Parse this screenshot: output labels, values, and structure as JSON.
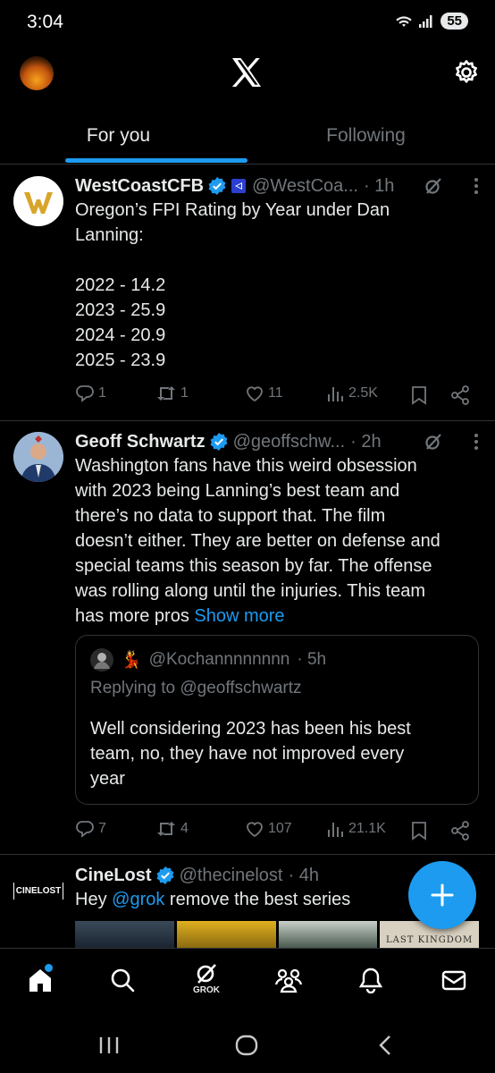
{
  "status_bar": {
    "time": "3:04",
    "battery": "55"
  },
  "tabs": {
    "for_you": "For you",
    "following": "Following"
  },
  "posts": [
    {
      "name": "WestCoastCFB",
      "handle": "@WestCoa...",
      "time": "· 1h",
      "text_lines": [
        "Oregon’s FPI Rating by Year under Dan",
        "Lanning:",
        "",
        "2022 - 14.2",
        "2023 - 25.9",
        "2024 - 20.9",
        "2025 - 23.9"
      ],
      "replies": "1",
      "reposts": "1",
      "likes": "11",
      "views": "2.5K"
    },
    {
      "name": "Geoff Schwartz",
      "handle": "@geoffschw...",
      "time": "· 2h",
      "text_lines": [
        "Washington fans have this weird obsession",
        "with 2023 being Lanning’s best team and",
        "there’s no data to support that. The film",
        "doesn’t either. They are better on defense and",
        "special teams this season by far. The offense",
        "was rolling along until the injuries. This team"
      ],
      "text_last": "has more pros",
      "show_more": "Show more",
      "quote": {
        "emoji": "💃",
        "handle": "@Kochannnnnnnn",
        "time": "· 5h",
        "replying_to": "Replying to @geoffschwartz",
        "text_lines": [
          "Well considering 2023 has been his best",
          "team, no, they have not improved every",
          "year"
        ]
      },
      "replies": "7",
      "reposts": "4",
      "likes": "107",
      "views": "21.1K"
    },
    {
      "name": "CineLost",
      "handle": "@thecinelost",
      "time": "· 4h",
      "text_prefix": "Hey",
      "mention": "@grok",
      "text_suffix": "remove the best series",
      "media_caption": "LAST KINGDOM",
      "avatar_text": "CINELOST"
    }
  ],
  "bottom_nav": {
    "grok_label": "GROK"
  },
  "icons": {
    "settings": "gear-icon",
    "home": "home-icon",
    "search": "search-icon",
    "grok": "grok-icon",
    "communities": "communities-icon",
    "notifications": "bell-icon",
    "messages": "mail-icon",
    "compose": "plus-icon"
  },
  "colors": {
    "accent": "#1d9bf0",
    "text": "#e7e9ea",
    "muted": "#71767b",
    "divider": "#2f3336"
  }
}
